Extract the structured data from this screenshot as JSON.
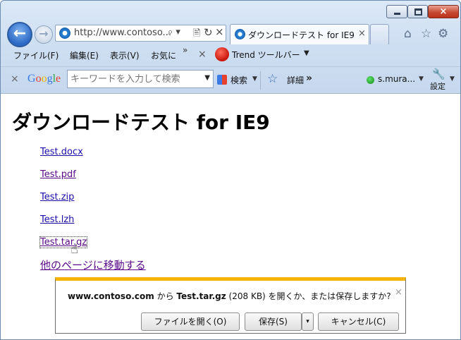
{
  "window": {
    "controls": {
      "minimize": "minimize",
      "maximize": "maximize",
      "close": "×"
    }
  },
  "nav": {
    "back_icon": "back-arrow",
    "forward_icon": "forward-arrow",
    "address_url": "http://www.contoso...",
    "address_tools": [
      "⌕ ▾",
      "🖹",
      "↻",
      "×"
    ]
  },
  "tabs": [
    {
      "title": "ダウンロードテスト for IE9",
      "close": "×",
      "active": true
    }
  ],
  "right_icons": [
    "home-icon",
    "star-icon",
    "gear-icon"
  ],
  "menubar": {
    "items": [
      "ファイル(F)",
      "編集(E)",
      "表示(V)",
      "お気に"
    ],
    "more": "»",
    "close": "×",
    "trend_label": "Trend ツールバー",
    "trend_dd": "▼"
  },
  "google_toolbar": {
    "close": "×",
    "logo": "Google",
    "search_placeholder": "キーワードを入力して検索",
    "search_btn": "検索",
    "detail": "詳細",
    "more": "»",
    "user": "s.mura...",
    "settings": "設定"
  },
  "page": {
    "title": "ダウンロードテスト for IE9",
    "links": [
      {
        "text": "Test.docx",
        "visited": false
      },
      {
        "text": "Test.pdf",
        "visited": true
      },
      {
        "text": "Test.zip",
        "visited": false
      },
      {
        "text": "Test.lzh",
        "visited": false
      },
      {
        "text": "Test.tar.gz",
        "visited": true
      }
    ],
    "other_link": "他のページに移動する"
  },
  "notification": {
    "site": "www.contoso.com",
    "from": " から ",
    "file": "Test.tar.gz",
    "size": " (208 KB) ",
    "question": "を開くか、または保存しますか?",
    "close": "×",
    "open_btn": "ファイルを開く(O)",
    "save_btn": "保存(S)",
    "save_dd": "▾",
    "cancel_btn": "キャンセル(C)"
  },
  "colors": {
    "accent": "#f5b400",
    "link": "#1a0dab",
    "visited": "#5a0a8a"
  }
}
